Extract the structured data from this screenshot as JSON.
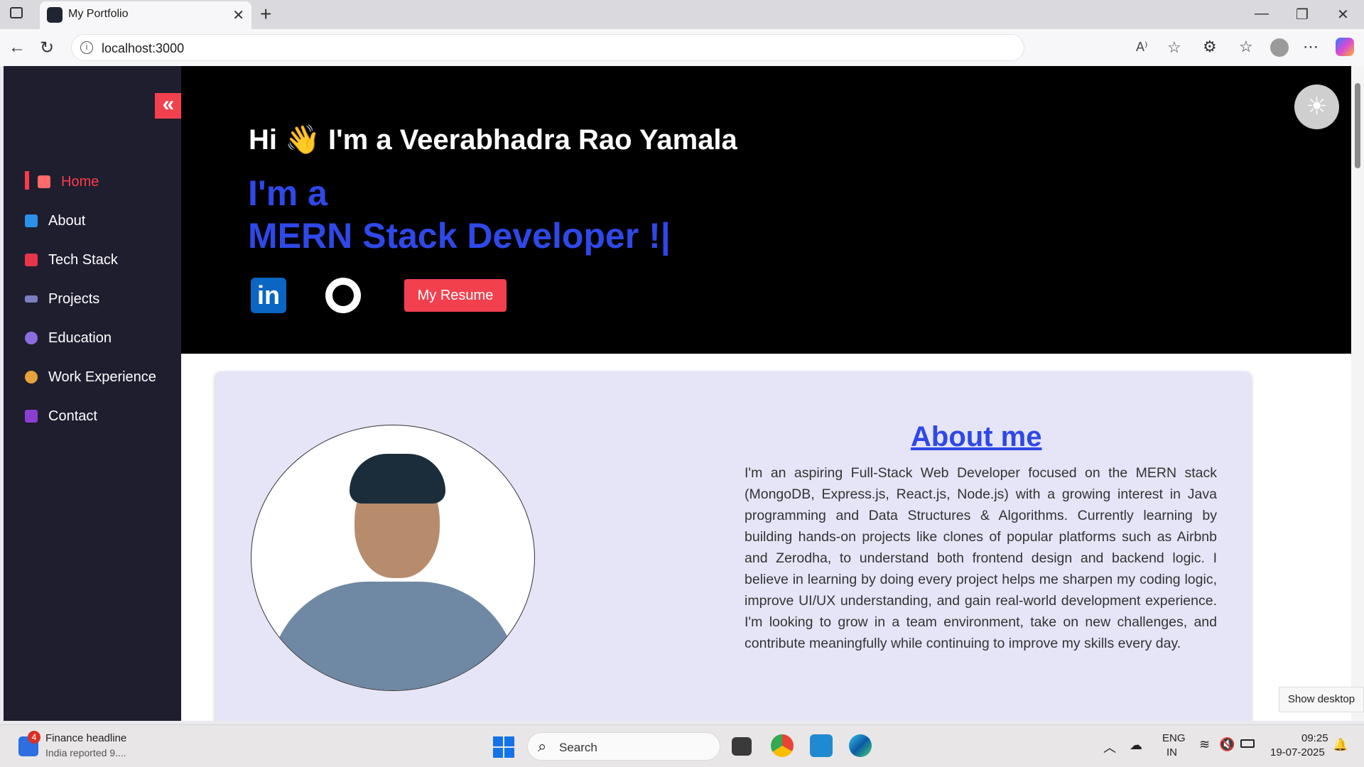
{
  "browser": {
    "tab_title": "My Portfolio",
    "url": "localhost:3000"
  },
  "sidebar": {
    "items": [
      {
        "label": "Home",
        "icon": "home-icon",
        "active": true
      },
      {
        "label": "About",
        "icon": "info-icon"
      },
      {
        "label": "Tech Stack",
        "icon": "tools-icon"
      },
      {
        "label": "Projects",
        "icon": "projects-icon"
      },
      {
        "label": "Education",
        "icon": "education-icon"
      },
      {
        "label": "Work Experience",
        "icon": "work-icon"
      },
      {
        "label": "Contact",
        "icon": "contact-icon"
      }
    ]
  },
  "hero": {
    "greeting": "Hi 👋 I'm a Veerabhadra Rao Yamala",
    "role_line1": "I'm a",
    "role_line2": "MERN Stack Developer !|",
    "linkedin_label": "in",
    "resume_label": "My Resume"
  },
  "about": {
    "title": "About me",
    "text": "I'm an aspiring Full-Stack Web Developer focused on the MERN stack (MongoDB, Express.js, React.js, Node.js) with a growing interest in Java programming and Data Structures & Algorithms. Currently learning by building hands-on projects like clones of popular platforms such as Airbnb and Zerodha, to understand both frontend design and backend logic. I believe in learning by doing every project helps me sharpen my coding logic, improve UI/UX understanding, and gain real-world development experience. I'm looking to grow in a team environment, take on new challenges, and contribute meaningfully while continuing to improve my skills every day."
  },
  "tooltip": {
    "show_desktop": "Show desktop"
  },
  "taskbar": {
    "news_badge": "4",
    "news_title": "Finance headline",
    "news_sub": "India reported 9....",
    "search_placeholder": "Search",
    "lang_line1": "ENG",
    "lang_line2": "IN",
    "time": "09:25",
    "date": "19-07-2025"
  },
  "colors": {
    "accent_red": "#f2404e",
    "accent_blue": "#2f48e8",
    "sidebar_bg": "#1f1e2e",
    "hero_bg": "#000000",
    "about_bg": "#e5e5f7"
  }
}
